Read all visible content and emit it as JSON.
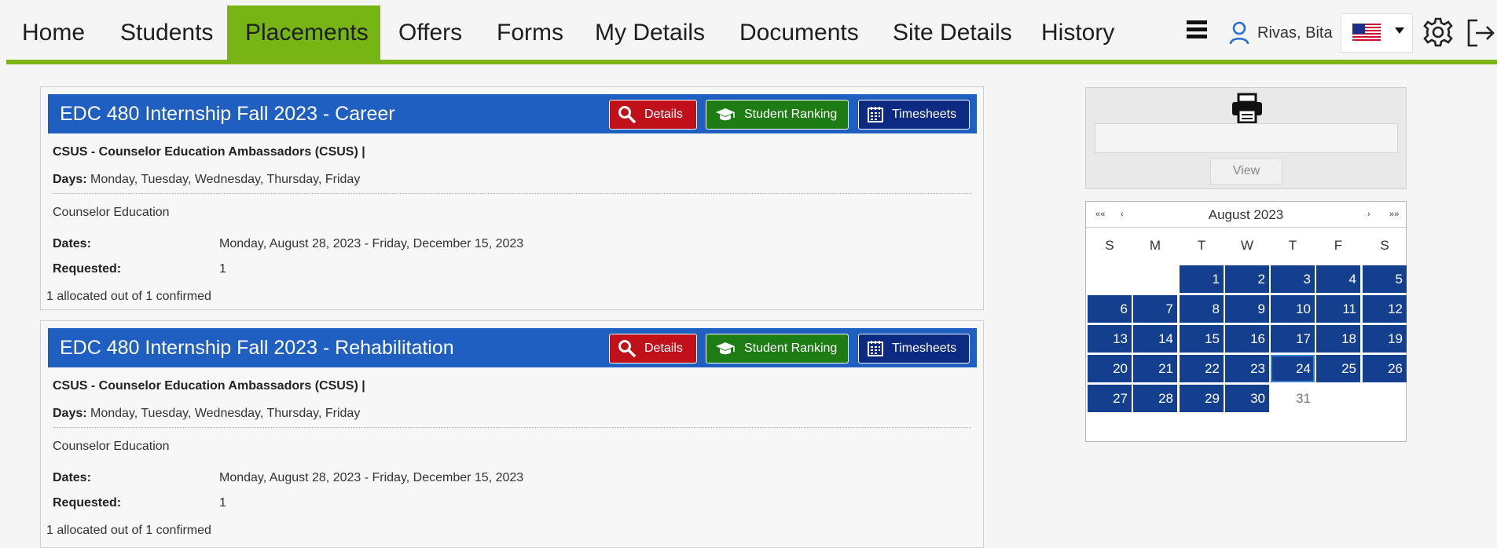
{
  "nav": {
    "items": [
      {
        "label": "Home"
      },
      {
        "label": "Students"
      },
      {
        "label": "Placements"
      },
      {
        "label": "Offers"
      },
      {
        "label": "Forms"
      },
      {
        "label": "My Details"
      },
      {
        "label": "Documents"
      },
      {
        "label": "Site Details"
      },
      {
        "label": "History"
      }
    ],
    "active": "Placements",
    "user_name": "Rivas, Bita",
    "language_icon": "us-flag-icon",
    "accent_color": "#7cb518"
  },
  "placements": [
    {
      "title": "EDC 480 Internship Fall 2023 - Career",
      "buttons": {
        "details": "Details",
        "ranking": "Student Ranking",
        "timesheets": "Timesheets"
      },
      "site": "CSUS - Counselor Education Ambassadors (CSUS) |",
      "days_label": "Days:",
      "days": "Monday, Tuesday, Wednesday, Thursday, Friday",
      "program": "Counselor Education",
      "dates_label": "Dates:",
      "dates": "Monday, August 28, 2023 - Friday, December 15, 2023",
      "requested_label": "Requested:",
      "requested": "1",
      "allocation": "1 allocated out of 1 confirmed"
    },
    {
      "title": "EDC 480 Internship Fall 2023 - Rehabilitation",
      "buttons": {
        "details": "Details",
        "ranking": "Student Ranking",
        "timesheets": "Timesheets"
      },
      "site": "CSUS - Counselor Education Ambassadors (CSUS) |",
      "days_label": "Days:",
      "days": "Monday, Tuesday, Wednesday, Thursday, Friday",
      "program": "Counselor Education",
      "dates_label": "Dates:",
      "dates": "Monday, August 28, 2023 - Friday, December 15, 2023",
      "requested_label": "Requested:",
      "requested": "1",
      "allocation": "1 allocated out of 1 confirmed"
    }
  ],
  "print_panel": {
    "input_value": "",
    "view_label": "View"
  },
  "calendar": {
    "month_label": "August 2023",
    "nav": {
      "prev_year": "««",
      "prev_month": "‹",
      "next_month": "›",
      "next_year": "»»"
    },
    "weekdays": [
      "S",
      "M",
      "T",
      "W",
      "T",
      "F",
      "S"
    ],
    "days": [
      "1",
      "2",
      "3",
      "4",
      "5",
      "6",
      "7",
      "8",
      "9",
      "10",
      "11",
      "12",
      "13",
      "14",
      "15",
      "16",
      "17",
      "18",
      "19",
      "20",
      "21",
      "22",
      "23",
      "24",
      "25",
      "26",
      "27",
      "28",
      "29",
      "30",
      "31"
    ],
    "highlighted_through": 30,
    "today": 24,
    "highlight_color": "#143f8f"
  }
}
